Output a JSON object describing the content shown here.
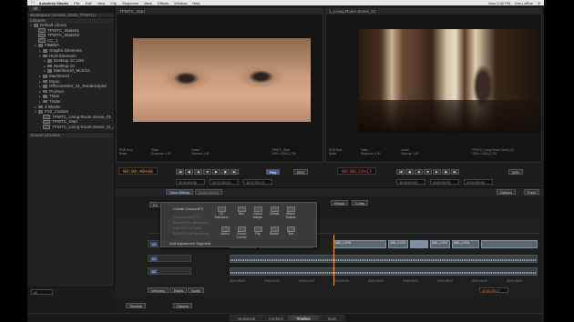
{
  "menubar": {
    "app": "Autodesk Smoke",
    "items": [
      "File",
      "Edit",
      "View",
      "Clip",
      "Sequence",
      "Mark",
      "Effects",
      "Window",
      "Help"
    ],
    "clock": "Mon 2:32 PM",
    "user": "Ken LaRue"
  },
  "library": {
    "tab": "All",
    "workspace": "Workspace (Smoke_2015_TPWTC)",
    "libraries_header": "Libraries",
    "items": [
      {
        "label": "Default Library",
        "kind": "folder",
        "depth": 0,
        "open": true
      },
      {
        "label": "TPWTC_Skate01",
        "kind": "clip",
        "depth": 1
      },
      {
        "label": "TPWTC_Skate02",
        "kind": "clip",
        "depth": 1
      },
      {
        "label": "CC_1",
        "kind": "clip",
        "depth": 1
      },
      {
        "label": "FIBBSA",
        "kind": "folder",
        "depth": 1,
        "open": true
      },
      {
        "label": "Graphic Elements",
        "kind": "folder",
        "depth": 2
      },
      {
        "label": "HUD Elements",
        "kind": "folder",
        "depth": 2,
        "open": true
      },
      {
        "label": "Desktop 10 12M",
        "kind": "folder",
        "depth": 3
      },
      {
        "label": "Desktop 10",
        "kind": "folder",
        "depth": 3
      },
      {
        "label": "Machine10_Mon/10",
        "kind": "folder",
        "depth": 3
      },
      {
        "label": "Machine10",
        "kind": "folder",
        "depth": 2
      },
      {
        "label": "Music",
        "kind": "folder",
        "depth": 2
      },
      {
        "label": "OffscreenSer_01_Renderdrpkd",
        "kind": "folder",
        "depth": 2
      },
      {
        "label": "Prorhon",
        "kind": "folder",
        "depth": 2
      },
      {
        "label": "TMax",
        "kind": "folder",
        "depth": 2
      },
      {
        "label": "Tinder",
        "kind": "folder",
        "depth": 2
      },
      {
        "label": "Z Blocks",
        "kind": "folder",
        "depth": 1
      },
      {
        "label": "FX0_Custom",
        "kind": "folder",
        "depth": 1,
        "open": true
      },
      {
        "label": "TPWTC_Living Room Scene_01",
        "kind": "clip",
        "depth": 2
      },
      {
        "label": "TPWTC_Start",
        "kind": "clip",
        "depth": 2
      },
      {
        "label": "TPWTC_Living Room Scene_01_source",
        "kind": "clip",
        "depth": 2
      }
    ],
    "shared_header": "Shared Libraries",
    "bottom_field": "All"
  },
  "viewer_left": {
    "title": "TPWTC_Start",
    "meta_left": "RGB Rsrc\nBinter",
    "meta_mid": "Video\nExposure: 0.00",
    "meta_mid2": "Linear\nGamma: 1.00",
    "meta_right": "TPWTC_Start\n1920 x 1080 (1.78)",
    "timecode": "00:00:40+06",
    "fields": [
      "00:00:40+06",
      "00:12:33+13",
      "00:12:33+13"
    ],
    "labels": [
      "In",
      "Out"
    ],
    "play_label": "Play",
    "zoom": "20%"
  },
  "viewer_right": {
    "title": "1_Living Room Scene_01",
    "meta_left": "RGB Rsrc\nBinter",
    "meta_mid": "Video\nExposure: 0.00",
    "meta_mid2": "Linear\nGamma: 1.00",
    "meta_right": "TPWTC_Living Room Scene_01\n1920 x 1080 (1.78)",
    "timecode": "00:00:23+17",
    "fields": [
      "00:00:00+00",
      "00:00:00+00",
      "00:00:00+00"
    ],
    "zoom": "40%"
  },
  "toolbar": {
    "effects_tab": "Video Effects",
    "audio_tab": "Audio Effects",
    "result_label": "Result",
    "comp_label": "Comp",
    "fx_label": "FX",
    "options_label": "Options",
    "fund_label": "Fund",
    "trim_label": "Trim",
    "link_label": "Link",
    "ripple_label": "Ripple",
    "snap_label": "Snap",
    "sync_label": "Sync"
  },
  "effects_menu": {
    "create_item": "Create ConnectFX",
    "disabled_items": [
      "Create Batch FX",
      "Add BFX to Selected...",
      "Add BFX to Track",
      "Add BFX to Sequence"
    ],
    "adjust_item": "Add Adjustment Segment",
    "row1": [
      "2D Transform",
      "Blur",
      "Colour Warper",
      "CMask",
      "Stereo Toolbox"
    ],
    "row2": [
      "Action",
      "Colour Correct",
      "Flip",
      "Resize",
      "Text"
    ]
  },
  "timeline": {
    "tracks": [
      "V1",
      "A1",
      "A2"
    ],
    "clip_labels": [
      "ABB_CXEN",
      "ABB_CXEN",
      "ABB_CXEN",
      "ABB_CXEN"
    ],
    "ruler": [
      "00:00:05:00",
      "00:00:10:00",
      "00:00:15:00",
      "00:00:20:00",
      "00:00:25:00",
      "00:00:30:00",
      "00:00:35:00",
      "00:00:40:00",
      "00:00:45:00"
    ],
    "bottom_controls": [
      "Versions",
      "Tracks",
      "Audio"
    ],
    "current_tc": "00:00:23+17",
    "seq_label": "Timeline",
    "options_label": "Options"
  },
  "bottom_tabs": [
    {
      "label": "MediaHub",
      "active": false
    },
    {
      "label": "Conform",
      "active": false
    },
    {
      "label": "Timeline",
      "active": true
    },
    {
      "label": "Tools",
      "active": false
    }
  ],
  "colors": {
    "accent_orange": "#ff9a2e",
    "timecode_red": "#ff5050",
    "selected_blue": "#3a5fa5"
  }
}
